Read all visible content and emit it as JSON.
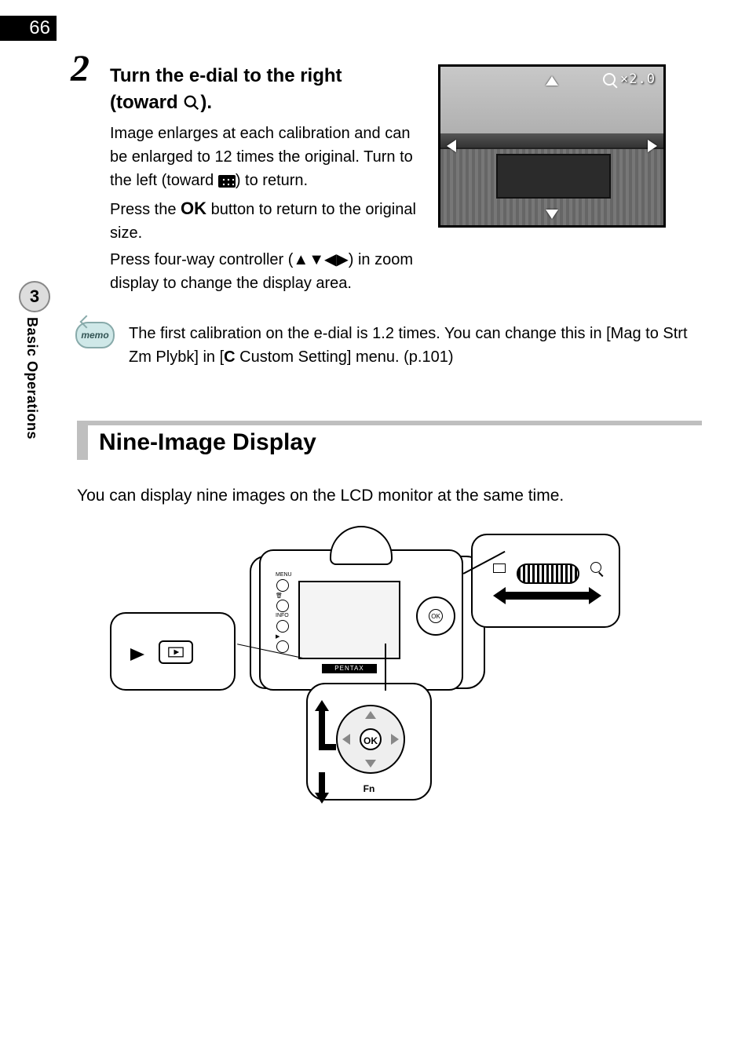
{
  "page_number": "66",
  "chapter_number": "3",
  "side_label": "Basic Operations",
  "step": {
    "number": "2",
    "title_a": "Turn the e-dial to the right",
    "title_b": "(toward ",
    "title_c": ")."
  },
  "body": {
    "p1a": "Image enlarges at each calibration and can be enlarged to 12 times the original. Turn to the left (toward ",
    "p1b": ") to return.",
    "p2a": "Press the ",
    "ok": "OK",
    "p2b": " button to return to the original size.",
    "p3": "Press four-way controller (▲▼◀▶) in zoom display to change the display area."
  },
  "lcd": {
    "zoom": "×2.0"
  },
  "memo": {
    "label": "memo",
    "text_a": "The first calibration on the e-dial is 1.2 times. You can change this in [Mag to Strt Zm Plybk] in [",
    "c": "C",
    "text_b": " Custom Setting] menu. (p.101)"
  },
  "section": {
    "title": "Nine-Image Display",
    "body": "You can display nine images on the LCD monitor at the same time."
  },
  "diagram": {
    "brand": "PENTAX",
    "ok": "OK",
    "fn": "Fn"
  }
}
